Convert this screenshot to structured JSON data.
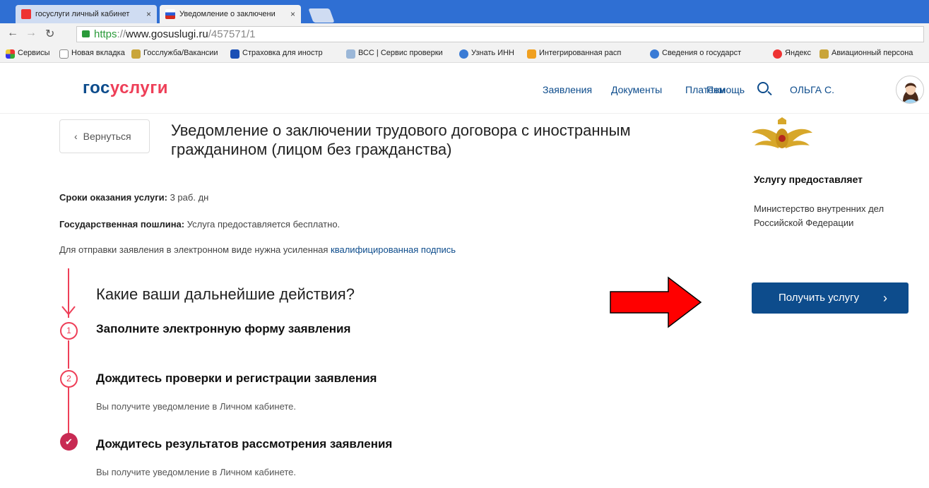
{
  "browser": {
    "tabs": [
      {
        "label": "госуслуги личный кабинет",
        "active": false
      },
      {
        "label": "Уведомление о заключени",
        "active": true
      }
    ],
    "tab_close": "×",
    "url": {
      "scheme": "https",
      "separator": "://",
      "host": "www.gosuslugi.ru",
      "path": "/457571/1"
    },
    "bookmarks": [
      "Сервисы",
      "Новая вкладка",
      "Госслужба/Вакансии",
      "Страховка для иностр",
      "ВСС | Сервис проверки",
      "Узнать ИНН",
      "Интегрированная расп",
      "Сведения о государст",
      "Яндекс",
      "Авиационный персона"
    ]
  },
  "header": {
    "logo_part1": "гос",
    "logo_part2": "услуги",
    "nav": [
      "Заявления",
      "Документы",
      "Платежи",
      "Помощь"
    ],
    "user": "ОЛЬГА С."
  },
  "main": {
    "back_label": "Вернуться",
    "title": "Уведомление о заключении трудового договора с иностранным гражданином (лицом без гражданства)",
    "terms_label": "Сроки оказания услуги:",
    "terms_value": "3 раб. дн",
    "fee_label": "Государственная пошлина:",
    "fee_value": "Услуга предоставляется бесплатно.",
    "signature_text": "Для отправки заявления в электронном виде нужна усиленная",
    "signature_link": "квалифицированная подпись",
    "question": "Какие ваши дальнейшие действия?",
    "steps": [
      {
        "num": "1",
        "title": "Заполните электронную форму заявления",
        "sub": ""
      },
      {
        "num": "2",
        "title": "Дождитесь проверки и регистрации заявления",
        "sub": "Вы получите уведомление в Личном кабинете."
      },
      {
        "num": "✔",
        "title": "Дождитесь результатов рассмотрения заявления",
        "sub": "Вы получите уведомление в Личном кабинете."
      }
    ]
  },
  "sidebar": {
    "provider_heading": "Услугу предоставляет",
    "provider_name": "Министерство внутренних дел Российской Федерации",
    "button_label": "Получить услугу"
  },
  "colors": {
    "brand_blue": "#0d4c8c",
    "brand_red": "#ee3f58",
    "annotation_arrow": "#ff0000"
  }
}
